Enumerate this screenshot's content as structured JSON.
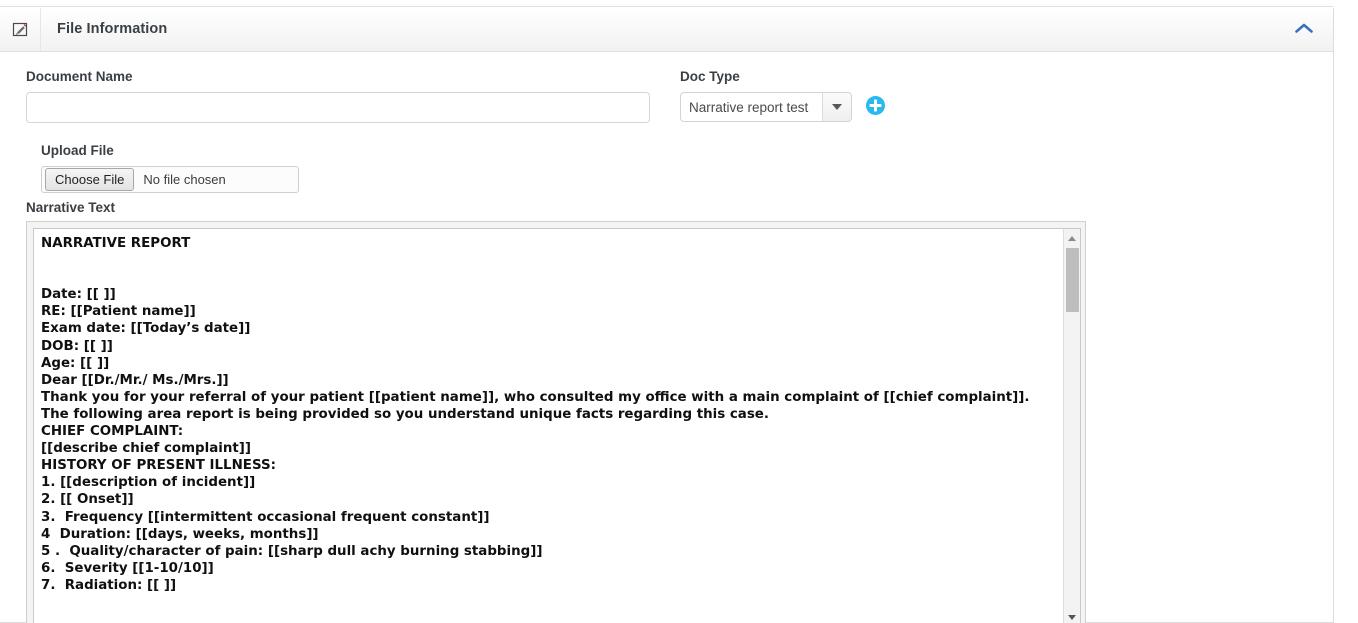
{
  "panel": {
    "title": "File Information",
    "edit_icon": "edit-square-pencil-icon",
    "collapse_icon": "chevron-up-icon",
    "accent_color": "#3a73b8",
    "add_icon_color": "#2ab9ef"
  },
  "form": {
    "document_name": {
      "label": "Document Name",
      "value": "",
      "placeholder": ""
    },
    "doc_type": {
      "label": "Doc Type",
      "selected": "Narrative report test",
      "dropdown_icon": "caret-down-icon",
      "add_button": {
        "icon": "plus-circle-icon",
        "title": "Add"
      }
    },
    "upload_file": {
      "label": "Upload File",
      "button_label": "Choose File",
      "status": "No file chosen"
    },
    "narrative_text": {
      "label": "Narrative Text",
      "value": "NARRATIVE REPORT\n\n\nDate: [[ ]]\nRE: [[Patient name]]\nExam date: [[Today’s date]]\nDOB: [[ ]]\nAge: [[ ]]\nDear [[Dr./Mr./ Ms./Mrs.]]\nThank you for your referral of your patient [[patient name]], who consulted my office with a main complaint of [[chief complaint]].\nThe following area report is being provided so you understand unique facts regarding this case.\nCHIEF COMPLAINT:\n[[describe chief complaint]]\nHISTORY OF PRESENT ILLNESS:\n1. [[description of incident]]\n2. [[ Onset]]\n3.  Frequency [[intermittent occasional frequent constant]]\n4  Duration: [[days, weeks, months]]\n5 .  Quality/character of pain: [[sharp dull achy burning stabbing]]\n6.  Severity [[1-10/10]]\n7.  Radiation: [[ ]]",
      "scrollbar": {
        "up_icon": "scroll-up-arrow-icon",
        "down_icon": "scroll-down-arrow-icon"
      }
    }
  }
}
